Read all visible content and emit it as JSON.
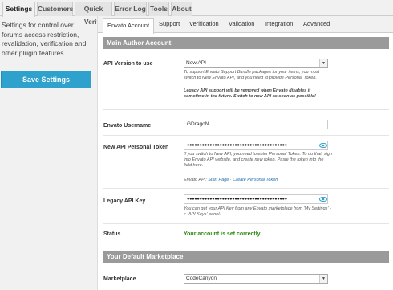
{
  "top_tabs": [
    {
      "label": "Settings",
      "active": true
    },
    {
      "label": "Customers",
      "active": false
    },
    {
      "label": "Quick Verify",
      "active": false
    },
    {
      "label": "Error Log",
      "active": false
    },
    {
      "label": "Tools",
      "active": false
    },
    {
      "label": "About",
      "active": false
    }
  ],
  "sidebar": {
    "description": "Settings for control over forums access restriction, revalidation, verification and other plugin features.",
    "save_label": "Save Settings"
  },
  "sub_tabs": [
    {
      "label": "Envato Account",
      "active": true
    },
    {
      "label": "Support",
      "active": false
    },
    {
      "label": "Verification",
      "active": false
    },
    {
      "label": "Validation",
      "active": false
    },
    {
      "label": "Integration",
      "active": false
    },
    {
      "label": "Advanced",
      "active": false
    }
  ],
  "main_author": {
    "header": "Main Author Account",
    "api_version": {
      "label": "API Version to use",
      "value": "New API",
      "help_1": "To support Envato Support Bundle packages for your items, you must switch to New Envato API, and you need to provide Personal Token.",
      "help_2": "Legacy API support will be removed when Envato disables it sometime in the future. Switch to new API as soon as possible!"
    },
    "username": {
      "label": "Envato Username",
      "value": "GDragoN"
    },
    "token": {
      "label": "New API Personal Token",
      "masked": "●●●●●●●●●●●●●●●●●●●●●●●●●●●●●●●●●●●●●●●●",
      "help": "If you switch to New API, you need to enter Personal Token. To do that, sign into Envato API website, and create new token. Paste the token into the field here.",
      "links_prefix": "Envato API:",
      "link_start": "Start Page",
      "link_sep": " · ",
      "link_create": "Create Personal Token"
    },
    "legacy_key": {
      "label": "Legacy API Key",
      "masked": "●●●●●●●●●●●●●●●●●●●●●●●●●●●●●●●●●●●●●●●●",
      "help": "You can get your API Key from any Envato marketplace from 'My Settings' -> 'API Keys' panel."
    },
    "status": {
      "label": "Status",
      "value": "Your account is set correctly."
    }
  },
  "marketplace_section": {
    "header": "Your Default Marketplace",
    "label": "Marketplace",
    "value": "CodeCanyon"
  },
  "colors": {
    "accent": "#2ea2cc",
    "section_header": "#9a9a9a",
    "success": "#2d8a12",
    "link": "#2271b1",
    "eye_icon": "#2ea2cc"
  },
  "icons": {
    "dropdown": "chevron-down-icon",
    "reveal": "eye-icon"
  }
}
